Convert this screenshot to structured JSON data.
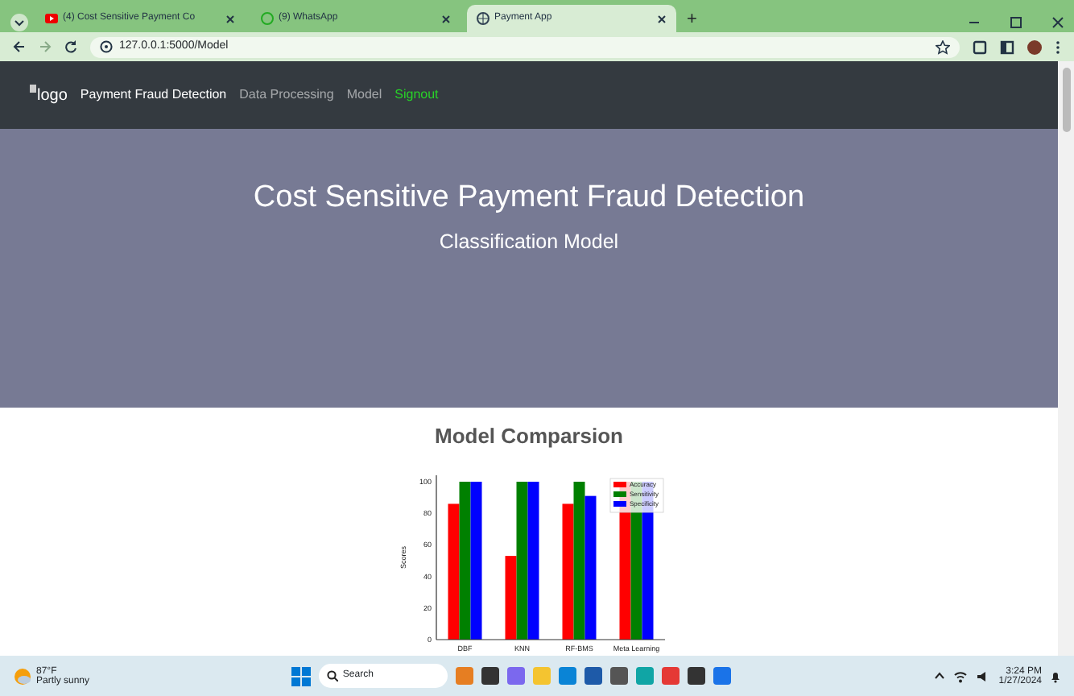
{
  "browser": {
    "tabs": [
      {
        "title": "(4) Cost Sensitive Payment Co",
        "selected": false,
        "kind": "video"
      },
      {
        "title": "(9) WhatsApp",
        "selected": false,
        "kind": "chat"
      },
      {
        "title": "Payment App",
        "selected": true,
        "kind": "globe"
      }
    ],
    "new_tab": "+",
    "address": "127.0.0.1:5000/Model"
  },
  "navbar": {
    "logo_alt": "logo",
    "links": [
      {
        "label": "Payment Fraud Detection",
        "kind": "brand"
      },
      {
        "label": "Data Processing",
        "kind": "link"
      },
      {
        "label": "Model",
        "kind": "link"
      },
      {
        "label": "Signout",
        "kind": "signout"
      }
    ]
  },
  "hero": {
    "title": "Cost Sensitive Payment Fraud Detection",
    "subtitle": "Classification Model"
  },
  "section": {
    "title": "Model Comparsion",
    "chart_data": {
      "type": "bar",
      "ylabel": "Scores",
      "legend": "upper right",
      "categories": [
        "DBF",
        "KNN",
        "RF-BMS",
        "Meta Learning"
      ],
      "ylim": [
        0,
        100
      ],
      "yticks": [
        0,
        20,
        40,
        60,
        80,
        100
      ],
      "series": [
        {
          "name": "Accuracy",
          "color": "#ff0000",
          "values": [
            86,
            53,
            86,
            100
          ]
        },
        {
          "name": "Sensitivity",
          "color": "#008000",
          "values": [
            100,
            100,
            100,
            100
          ]
        },
        {
          "name": "Specificity",
          "color": "#0000ff",
          "values": [
            100,
            100,
            91,
            100
          ]
        }
      ]
    }
  },
  "taskbar": {
    "weather": {
      "temp": "87°F",
      "condition": "Partly sunny"
    },
    "search": "Search",
    "time": "3:24 PM",
    "date": "1/27/2024"
  }
}
